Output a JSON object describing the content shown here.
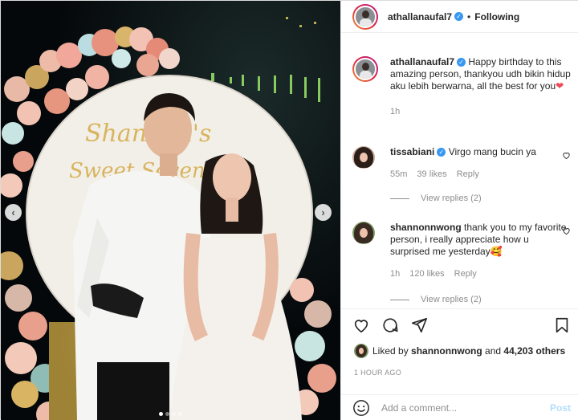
{
  "post": {
    "author": "athallanaufal7",
    "follow_status": "Following",
    "separator": "•"
  },
  "caption": {
    "username": "athallanaufal7",
    "text": "Happy birthday to this amazing person, thankyou udh bikin hidup aku lebih berwarna, all the best for you",
    "emoji": "❤",
    "time": "1h"
  },
  "comments": [
    {
      "username": "tissabiani",
      "verified": true,
      "text": "Virgo mang bucin ya",
      "time": "55m",
      "likes": "39 likes",
      "reply": "Reply",
      "view_replies": "View replies (2)"
    },
    {
      "username": "shannonnwong",
      "verified": false,
      "text": "thank you to my favorite person, i really appreciate how u surprised me yesterday",
      "emoji": "🥰",
      "time": "1h",
      "likes": "120 likes",
      "reply": "Reply",
      "view_replies": "View replies (2)"
    }
  ],
  "liked_by": {
    "prefix": "Liked by",
    "user": "shannonnwong",
    "and": "and",
    "others": "44,203 others"
  },
  "timestamp": "1 HOUR AGO",
  "add_comment": {
    "placeholder": "Add a comment...",
    "post_label": "Post"
  },
  "photo": {
    "backdrop_text_line1": "Shannon's",
    "backdrop_text_line2": "Sweet Seventeen"
  },
  "carousel": {
    "total": 4,
    "active": 1
  },
  "colors": {
    "verified": "#3897f0",
    "heart": "#ed4956",
    "post_button": "#b2dffc",
    "muted_text": "#8e8e8e"
  },
  "icons": [
    "heart-icon",
    "comment-icon",
    "share-icon",
    "bookmark-icon",
    "emoji-icon",
    "chevron-left-icon",
    "chevron-right-icon",
    "verified-icon"
  ]
}
